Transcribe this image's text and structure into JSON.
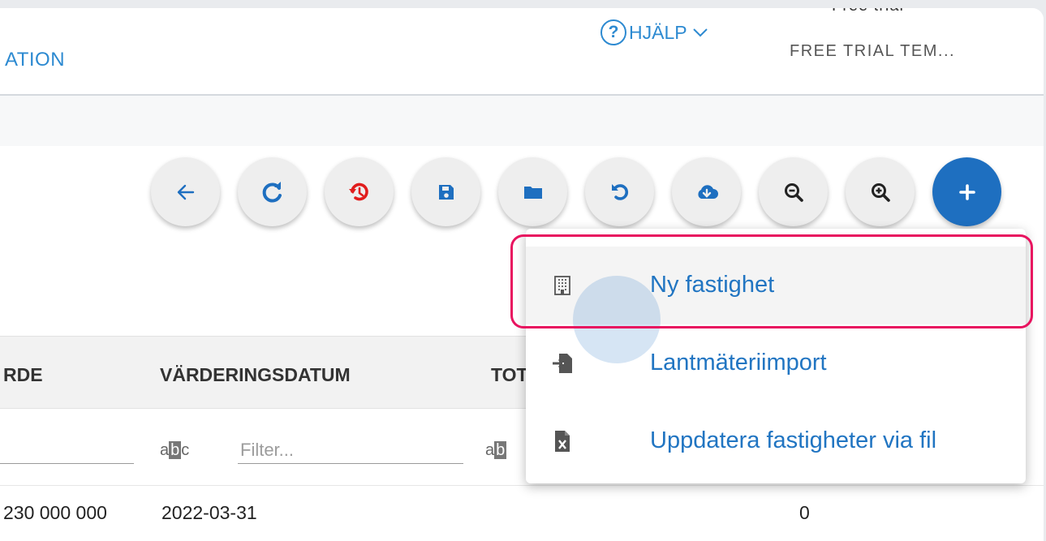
{
  "header": {
    "nav_partial": "ATION",
    "help_label": "HJÄLP",
    "help_icon": "question-circle-icon",
    "trial_top": "Free trial",
    "trial_label": "FREE TRIAL TEM..."
  },
  "toolbar": {
    "buttons": [
      {
        "name": "back-button",
        "icon": "arrow-left-icon"
      },
      {
        "name": "refresh-button",
        "icon": "refresh-icon"
      },
      {
        "name": "history-button",
        "icon": "history-icon"
      },
      {
        "name": "save-button",
        "icon": "save-icon"
      },
      {
        "name": "open-folder-button",
        "icon": "folder-icon"
      },
      {
        "name": "undo-button",
        "icon": "undo-icon"
      },
      {
        "name": "cloud-download-button",
        "icon": "cloud-download-icon"
      },
      {
        "name": "zoom-out-button",
        "icon": "zoom-out-icon"
      },
      {
        "name": "zoom-in-button",
        "icon": "zoom-in-icon"
      },
      {
        "name": "add-button",
        "icon": "plus-icon"
      }
    ],
    "accent": "#1e6fc0"
  },
  "table": {
    "headers": [
      "RDE",
      "VÄRDERINGSDATUM",
      "TOT"
    ],
    "filter_placeholder": "Filter...",
    "abc_a": "a",
    "abc_b": "b",
    "abc_c": "c",
    "row": {
      "value": "230 000 000",
      "date": "2022-03-31",
      "total": "0"
    }
  },
  "menu": {
    "items": [
      {
        "label": "Ny fastighet",
        "icon": "building-icon"
      },
      {
        "label": "Lantmäteriimport",
        "icon": "file-import-icon"
      },
      {
        "label": "Uppdatera fastigheter via fil",
        "icon": "excel-file-icon"
      }
    ],
    "highlight_color": "#e8135f"
  }
}
